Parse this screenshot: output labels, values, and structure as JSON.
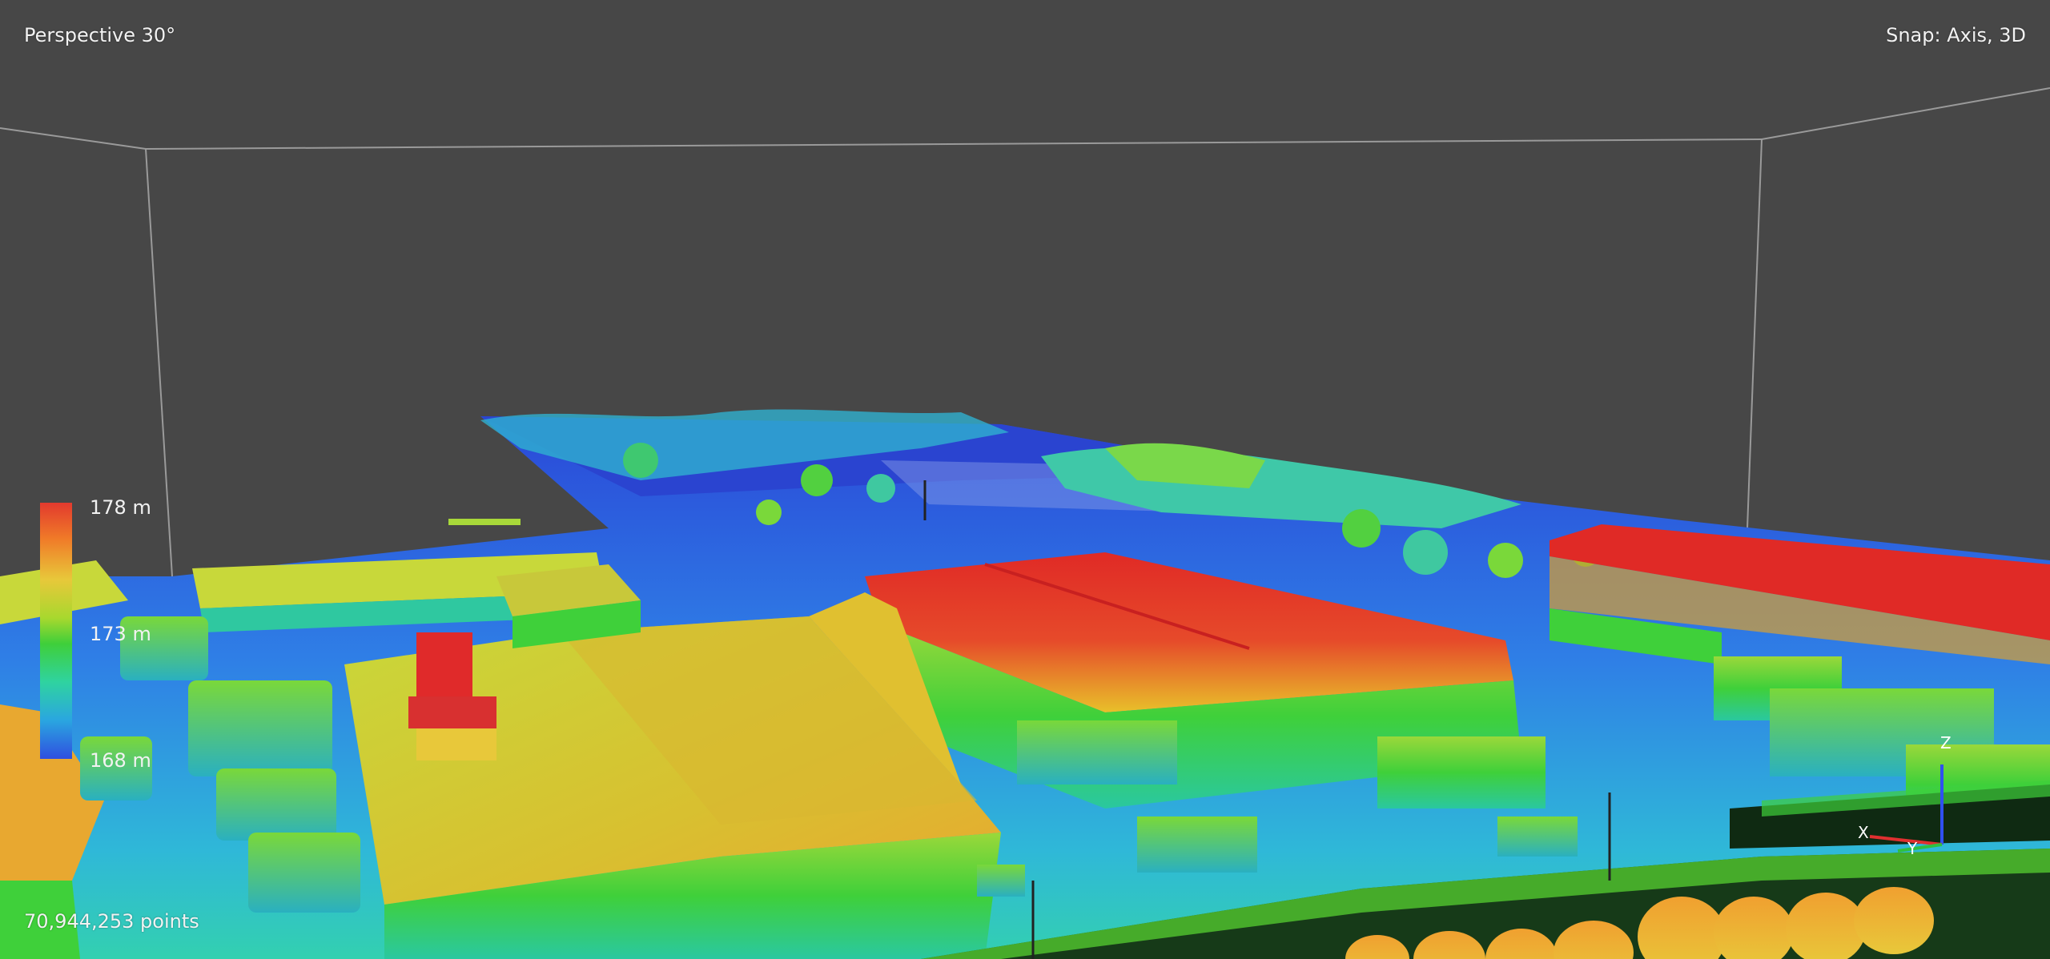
{
  "viewport": {
    "camera_mode": "Perspective 30°",
    "snap_mode": "Snap: Axis, 3D",
    "point_count": "70,944,253 points"
  },
  "color_scale": {
    "max_label": "178 m",
    "mid_label": "173 m",
    "min_label": "168 m",
    "colors": [
      "#e23a2e",
      "#e8c83a",
      "#3fcf3a",
      "#2fd3a0",
      "#2f4fe0"
    ]
  },
  "axis_gizmo": {
    "x_label": "X",
    "y_label": "Y",
    "z_label": "Z",
    "x_color": "#e03030",
    "y_color": "#30c040",
    "z_color": "#3050f0"
  }
}
